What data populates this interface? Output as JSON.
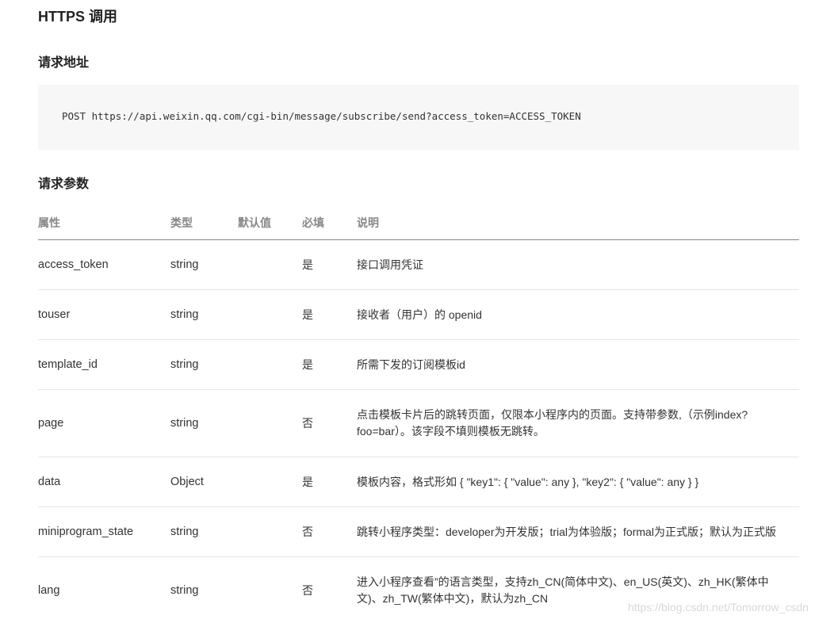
{
  "title": "HTTPS 调用",
  "request_url": {
    "heading": "请求地址",
    "code": "POST https://api.weixin.qq.com/cgi-bin/message/subscribe/send?access_token=ACCESS_TOKEN"
  },
  "params": {
    "heading": "请求参数",
    "columns": {
      "attr": "属性",
      "type": "类型",
      "default": "默认值",
      "required": "必填",
      "desc": "说明"
    },
    "rows": [
      {
        "attr": "access_token",
        "type": "string",
        "default": "",
        "required": "是",
        "desc": "接口调用凭证"
      },
      {
        "attr": "touser",
        "type": "string",
        "default": "",
        "required": "是",
        "desc": "接收者（用户）的 openid"
      },
      {
        "attr": "template_id",
        "type": "string",
        "default": "",
        "required": "是",
        "desc": "所需下发的订阅模板id"
      },
      {
        "attr": "page",
        "type": "string",
        "default": "",
        "required": "否",
        "desc": "点击模板卡片后的跳转页面，仅限本小程序内的页面。支持带参数,（示例index?foo=bar）。该字段不填则模板无跳转。"
      },
      {
        "attr": "data",
        "type": "Object",
        "default": "",
        "required": "是",
        "desc": "模板内容，格式形如 { \"key1\": { \"value\": any }, \"key2\": { \"value\": any } }"
      },
      {
        "attr": "miniprogram_state",
        "type": "string",
        "default": "",
        "required": "否",
        "desc": "跳转小程序类型：developer为开发版；trial为体验版；formal为正式版；默认为正式版"
      },
      {
        "attr": "lang",
        "type": "string",
        "default": "",
        "required": "否",
        "desc": "进入小程序查看”的语言类型，支持zh_CN(简体中文)、en_US(英文)、zh_HK(繁体中文)、zh_TW(繁体中文)，默认为zh_CN"
      }
    ]
  },
  "watermark": "https://blog.csdn.net/Tomorrow_csdn",
  "colors": {
    "link": "#576b95",
    "code_bg": "#f7f7f7"
  }
}
